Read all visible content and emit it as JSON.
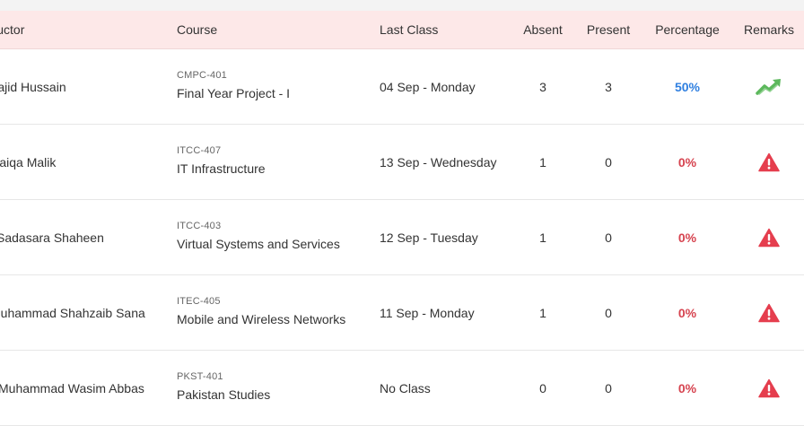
{
  "header": {
    "instructor": "Instructor",
    "course": "Course",
    "last_class": "Last Class",
    "absent": "Absent",
    "present": "Present",
    "percentage": "Percentage",
    "remarks": "Remarks"
  },
  "colors": {
    "header_bg": "#fde8e8",
    "good": "#2f7fe0",
    "bad": "#d6434f",
    "trend_up": "#5cb85c",
    "warning": "#e53e4e"
  },
  "rows": [
    {
      "instructor": "Sajid Hussain",
      "code": "CMPC-401",
      "course": "Final Year Project - I",
      "last_class": "04 Sep - Monday",
      "absent": "3",
      "present": "3",
      "percentage": "50%",
      "status": "good",
      "remark_icon": "trend-up-icon"
    },
    {
      "instructor": "Saiqa Malik",
      "code": "ITCC-407",
      "course": "IT Infrastructure",
      "last_class": "13 Sep - Wednesday",
      "absent": "1",
      "present": "0",
      "percentage": "0%",
      "status": "bad",
      "remark_icon": "warning-icon"
    },
    {
      "instructor": "Sadasara Shaheen",
      "code": "ITCC-403",
      "course": "Virtual Systems and Services",
      "last_class": "12 Sep - Tuesday",
      "absent": "1",
      "present": "0",
      "percentage": "0%",
      "status": "bad",
      "remark_icon": "warning-icon"
    },
    {
      "instructor": "Muhammad Shahzaib Sana",
      "code": "ITEC-405",
      "course": "Mobile and Wireless Networks",
      "last_class": "11 Sep - Monday",
      "absent": "1",
      "present": "0",
      "percentage": "0%",
      "status": "bad",
      "remark_icon": "warning-icon"
    },
    {
      "instructor": "Muhammad Wasim Abbas",
      "code": "PKST-401",
      "course": "Pakistan Studies",
      "last_class": "No Class",
      "absent": "0",
      "present": "0",
      "percentage": "0%",
      "status": "bad",
      "remark_icon": "warning-icon"
    }
  ]
}
